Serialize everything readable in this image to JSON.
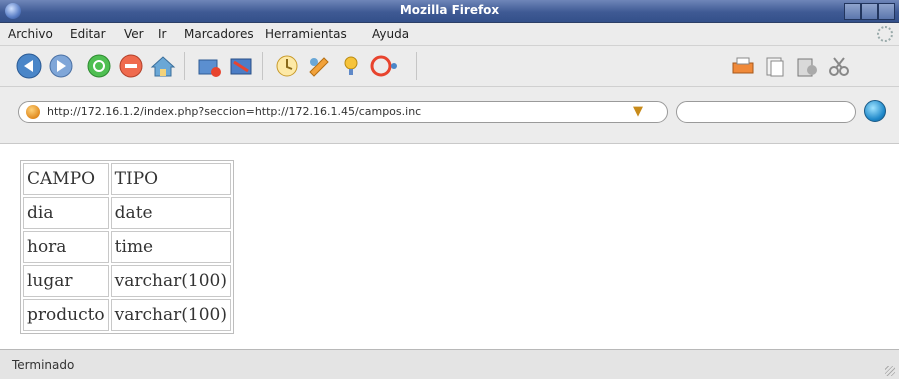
{
  "window": {
    "title": "Mozilla Firefox"
  },
  "menubar": {
    "items": [
      "Archivo",
      "Editar",
      "Ver",
      "Ir",
      "Marcadores",
      "Herramientas",
      "Ayuda"
    ]
  },
  "toolbar": {
    "icons": [
      "back-icon",
      "forward-icon",
      "reload-icon",
      "stop-icon",
      "home-icon",
      "bookmarks-icon",
      "history-icon",
      "downloads-icon",
      "tabs-icon",
      "tips-icon",
      "refresh-icon",
      "print-icon",
      "copy-icon",
      "paste-icon",
      "cut-icon"
    ]
  },
  "locationbar": {
    "url": "http://172.16.1.2/index.php?seccion=http://172.16.1.45/campos.inc",
    "search_value": ""
  },
  "content": {
    "table": {
      "headers": [
        "CAMPO",
        "TIPO"
      ],
      "rows": [
        [
          "dia",
          "date"
        ],
        [
          "hora",
          "time"
        ],
        [
          "lugar",
          "varchar(100)"
        ],
        [
          "producto",
          "varchar(100)"
        ]
      ]
    }
  },
  "statusbar": {
    "text": "Terminado"
  },
  "colors": {
    "titlebar": "#3f5a94",
    "chrome": "#ececec",
    "accent": "#1f88c9"
  }
}
